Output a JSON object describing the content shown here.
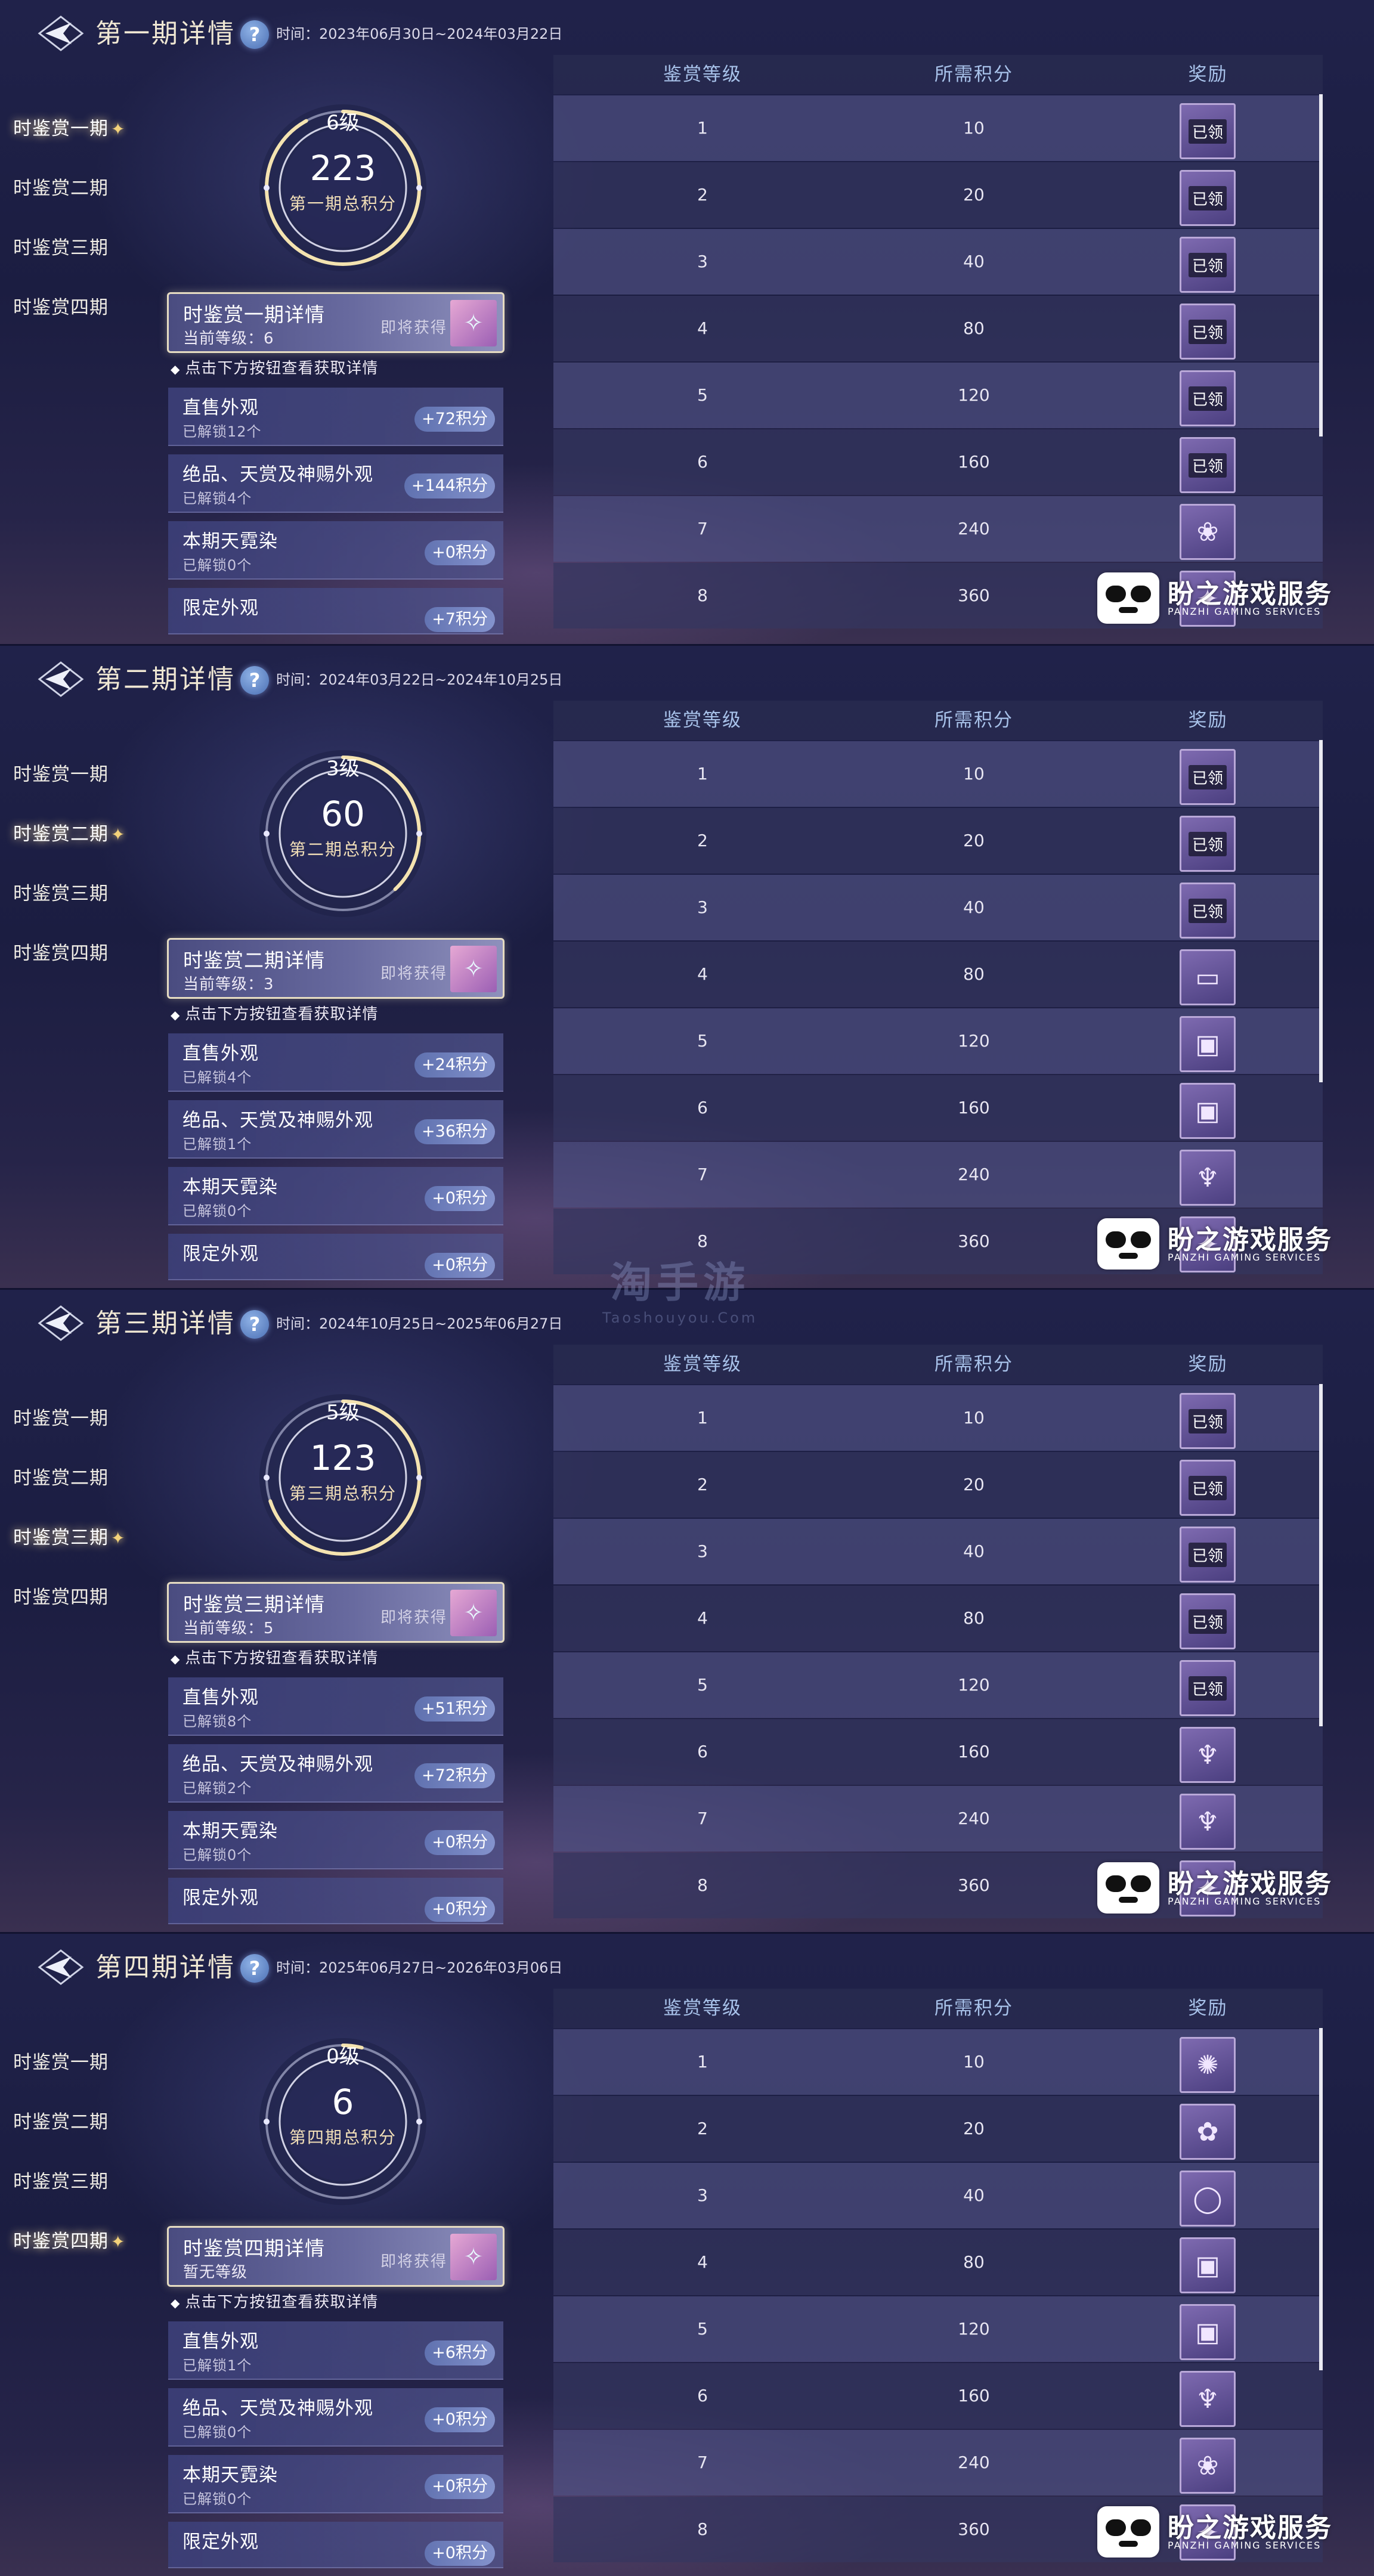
{
  "nav_items": [
    "时鉴赏一期",
    "时鉴赏二期",
    "时鉴赏三期",
    "时鉴赏四期"
  ],
  "table_headers": {
    "level": "鉴赏等级",
    "points": "所需积分",
    "reward": "奖励"
  },
  "hint": "点击下方按钮查看获取详情",
  "claimed_label": "已领",
  "watermark": {
    "text": "盼之游戏服务",
    "sub": "PANZHI GAMING SERVICES"
  },
  "center_watermark": {
    "text": "淘手游",
    "sub": "Taoshouyou.Com"
  },
  "colors": {
    "accent_gold": "#f3d27a",
    "header_text": "#a8c2ea",
    "background": "#1b1d3c"
  },
  "panels": [
    {
      "title": "第一期详情",
      "date": "时间：2023年06月30日~2024年03月22日",
      "active_nav": 0,
      "level": "6级",
      "score": "223",
      "score_label": "第一期总积分",
      "progress": 0.92,
      "detail_title": "时鉴赏一期详情",
      "detail_sub": "当前等级：6",
      "detail_status": "即将获得",
      "categories": [
        {
          "name": "直售外观",
          "unlocked": "已解锁12个",
          "points": "+72积分"
        },
        {
          "name": "绝品、天赏及神赐外观",
          "unlocked": "已解锁4个",
          "points": "+144积分"
        },
        {
          "name": "本期天霓染",
          "unlocked": "已解锁0个",
          "points": "+0积分"
        },
        {
          "name": "限定外观",
          "unlocked": "",
          "points": "+7积分"
        }
      ],
      "rows": [
        {
          "level": "1",
          "points": "10",
          "claimed": true,
          "icon": "gift-icon"
        },
        {
          "level": "2",
          "points": "20",
          "claimed": true,
          "icon": "gift-icon"
        },
        {
          "level": "3",
          "points": "40",
          "claimed": true,
          "icon": "gift-icon"
        },
        {
          "level": "4",
          "points": "80",
          "claimed": true,
          "icon": "gift-icon"
        },
        {
          "level": "5",
          "points": "120",
          "claimed": true,
          "icon": "gift-icon"
        },
        {
          "level": "6",
          "points": "160",
          "claimed": true,
          "icon": "gift-icon"
        },
        {
          "level": "7",
          "points": "240",
          "claimed": false,
          "icon": "fish-icon"
        },
        {
          "level": "8",
          "points": "360",
          "claimed": false,
          "icon": "gift-icon"
        }
      ]
    },
    {
      "title": "第二期详情",
      "date": "时间：2024年03月22日~2024年10月25日",
      "active_nav": 1,
      "level": "3级",
      "score": "60",
      "score_label": "第二期总积分",
      "progress": 0.38,
      "detail_title": "时鉴赏二期详情",
      "detail_sub": "当前等级：3",
      "detail_status": "即将获得",
      "categories": [
        {
          "name": "直售外观",
          "unlocked": "已解锁4个",
          "points": "+24积分"
        },
        {
          "name": "绝品、天赏及神赐外观",
          "unlocked": "已解锁1个",
          "points": "+36积分"
        },
        {
          "name": "本期天霓染",
          "unlocked": "已解锁0个",
          "points": "+0积分"
        },
        {
          "name": "限定外观",
          "unlocked": "",
          "points": "+0积分"
        }
      ],
      "rows": [
        {
          "level": "1",
          "points": "10",
          "claimed": true,
          "icon": "gift-icon"
        },
        {
          "level": "2",
          "points": "20",
          "claimed": true,
          "icon": "gift-icon"
        },
        {
          "level": "3",
          "points": "40",
          "claimed": true,
          "icon": "gift-icon"
        },
        {
          "level": "4",
          "points": "80",
          "claimed": false,
          "icon": "scene-icon"
        },
        {
          "level": "5",
          "points": "120",
          "claimed": false,
          "icon": "frame-icon"
        },
        {
          "level": "6",
          "points": "160",
          "claimed": false,
          "icon": "frame-icon"
        },
        {
          "level": "7",
          "points": "240",
          "claimed": false,
          "icon": "figure-icon"
        },
        {
          "level": "8",
          "points": "360",
          "claimed": false,
          "icon": "gift-icon"
        }
      ]
    },
    {
      "title": "第三期详情",
      "date": "时间：2024年10月25日~2025年06月27日",
      "active_nav": 2,
      "level": "5级",
      "score": "123",
      "score_label": "第三期总积分",
      "progress": 0.7,
      "detail_title": "时鉴赏三期详情",
      "detail_sub": "当前等级：5",
      "detail_status": "即将获得",
      "categories": [
        {
          "name": "直售外观",
          "unlocked": "已解锁8个",
          "points": "+51积分"
        },
        {
          "name": "绝品、天赏及神赐外观",
          "unlocked": "已解锁2个",
          "points": "+72积分"
        },
        {
          "name": "本期天霓染",
          "unlocked": "已解锁0个",
          "points": "+0积分"
        },
        {
          "name": "限定外观",
          "unlocked": "",
          "points": "+0积分"
        }
      ],
      "rows": [
        {
          "level": "1",
          "points": "10",
          "claimed": true,
          "icon": "gift-icon"
        },
        {
          "level": "2",
          "points": "20",
          "claimed": true,
          "icon": "gift-icon"
        },
        {
          "level": "3",
          "points": "40",
          "claimed": true,
          "icon": "gift-icon"
        },
        {
          "level": "4",
          "points": "80",
          "claimed": true,
          "icon": "gift-icon"
        },
        {
          "level": "5",
          "points": "120",
          "claimed": true,
          "icon": "gift-icon"
        },
        {
          "level": "6",
          "points": "160",
          "claimed": false,
          "icon": "figure-icon"
        },
        {
          "level": "7",
          "points": "240",
          "claimed": false,
          "icon": "figure-icon"
        },
        {
          "level": "8",
          "points": "360",
          "claimed": false,
          "icon": "gift-icon"
        }
      ]
    },
    {
      "title": "第四期详情",
      "date": "时间：2025年06月27日~2026年03月06日",
      "active_nav": 3,
      "level": "0级",
      "score": "6",
      "score_label": "第四期总积分",
      "progress": 0.04,
      "detail_title": "时鉴赏四期详情",
      "detail_sub": "暂无等级",
      "detail_status": "即将获得",
      "categories": [
        {
          "name": "直售外观",
          "unlocked": "已解锁1个",
          "points": "+6积分"
        },
        {
          "name": "绝品、天赏及神赐外观",
          "unlocked": "已解锁0个",
          "points": "+0积分"
        },
        {
          "name": "本期天霓染",
          "unlocked": "已解锁0个",
          "points": "+0积分"
        },
        {
          "name": "限定外观",
          "unlocked": "",
          "points": "+0积分"
        }
      ],
      "rows": [
        {
          "level": "1",
          "points": "10",
          "claimed": false,
          "icon": "ornament-icon"
        },
        {
          "level": "2",
          "points": "20",
          "claimed": false,
          "icon": "flower-icon"
        },
        {
          "level": "3",
          "points": "40",
          "claimed": false,
          "icon": "ring-icon"
        },
        {
          "level": "4",
          "points": "80",
          "claimed": false,
          "icon": "frame-icon"
        },
        {
          "level": "5",
          "points": "120",
          "claimed": false,
          "icon": "frame-icon"
        },
        {
          "level": "6",
          "points": "160",
          "claimed": false,
          "icon": "figure-icon"
        },
        {
          "level": "7",
          "points": "240",
          "claimed": false,
          "icon": "fish-icon"
        },
        {
          "level": "8",
          "points": "360",
          "claimed": false,
          "icon": "gift-icon"
        }
      ]
    }
  ]
}
